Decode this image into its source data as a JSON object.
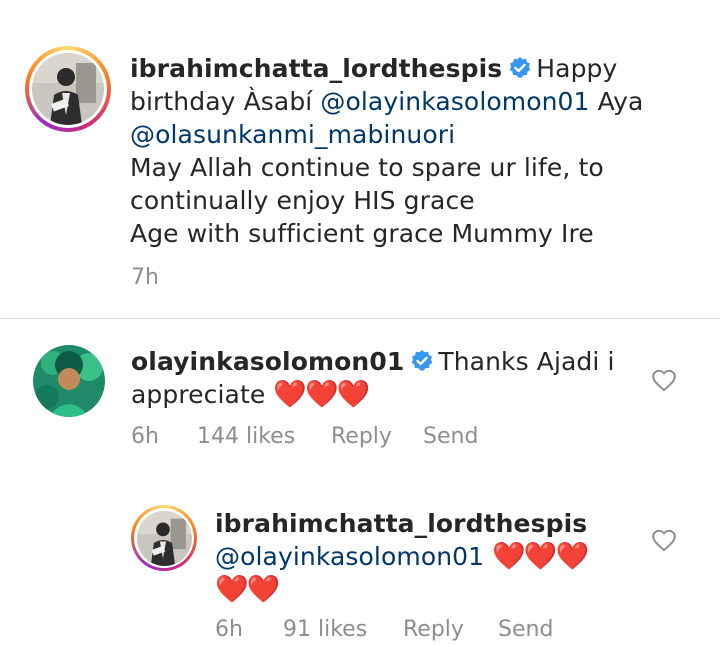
{
  "post_caption": {
    "username": "ibrahimchatta_lordthespis",
    "text_intro": "Happy",
    "line2_pre": "birthday Àsabí",
    "mention1": "@olayinkasolomon01",
    "line2_post": "Aya",
    "mention2": "@olasunkanmi_mabinuori",
    "line4": "May Allah continue to spare ur life, to",
    "line5": "continually enjoy HIS grace",
    "line6": "Age with sufficient grace Mummy Ire",
    "time": "7h"
  },
  "comment": {
    "username": "olayinkasolomon01",
    "text_line1": "Thanks Ajadi i",
    "text_line2": "appreciate",
    "hearts": "❤️❤️❤️",
    "time": "6h",
    "likes": "144 likes",
    "reply": "Reply",
    "send": "Send"
  },
  "reply": {
    "username": "ibrahimchatta_lordthespis",
    "mention": "@olayinkasolomon01",
    "hearts_line1": "❤️❤️❤️",
    "hearts_line2": "❤️❤️",
    "time": "6h",
    "likes": "91 likes",
    "reply": "Reply",
    "send": "Send"
  },
  "colors": {
    "verified": "#3897f0",
    "mention": "#00376b",
    "meta": "#8e8e8e",
    "heart": "#e0245e"
  },
  "icons": {
    "verified": "verified-badge-icon",
    "like": "heart-outline-icon"
  }
}
